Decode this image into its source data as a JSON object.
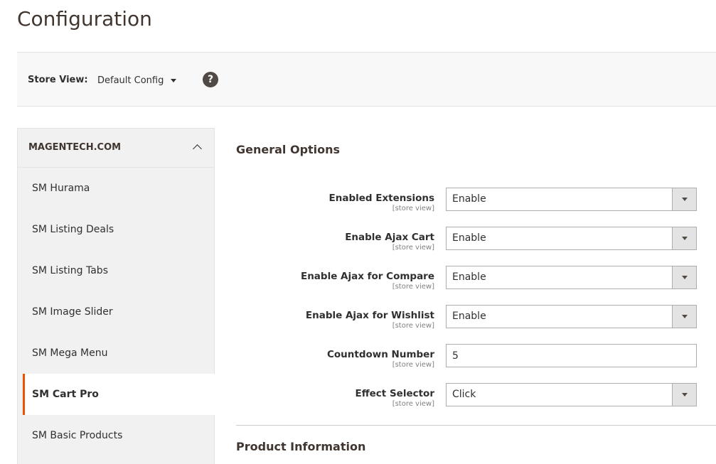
{
  "page": {
    "title": "Configuration"
  },
  "store_view": {
    "label": "Store View:",
    "value": "Default Config",
    "help": "?"
  },
  "sidebar": {
    "title": "MAGENTECH.COM",
    "items": [
      {
        "label": "SM Hurama"
      },
      {
        "label": "SM Listing Deals"
      },
      {
        "label": "SM Listing Tabs"
      },
      {
        "label": "SM Image Slider"
      },
      {
        "label": "SM Mega Menu"
      },
      {
        "label": "SM Cart Pro",
        "active": true
      },
      {
        "label": "SM Basic Products"
      }
    ]
  },
  "sections": {
    "general": {
      "title": "General Options"
    },
    "product": {
      "title": "Product Information"
    }
  },
  "fields": [
    {
      "label": "Enabled Extensions",
      "scope": "[store view]",
      "type": "select",
      "value": "Enable"
    },
    {
      "label": "Enable Ajax Cart",
      "scope": "[store view]",
      "type": "select",
      "value": "Enable"
    },
    {
      "label": "Enable Ajax for Compare",
      "scope": "[store view]",
      "type": "select",
      "value": "Enable"
    },
    {
      "label": "Enable Ajax for Wishlist",
      "scope": "[store view]",
      "type": "select",
      "value": "Enable"
    },
    {
      "label": "Countdown Number",
      "scope": "[store view]",
      "type": "text",
      "value": "5"
    },
    {
      "label": "Effect Selector",
      "scope": "[store view]",
      "type": "select",
      "value": "Click"
    }
  ],
  "colors": {
    "accent": "#eb5202",
    "sidebar_bg": "#f1f1f1",
    "title": "#41362f"
  }
}
